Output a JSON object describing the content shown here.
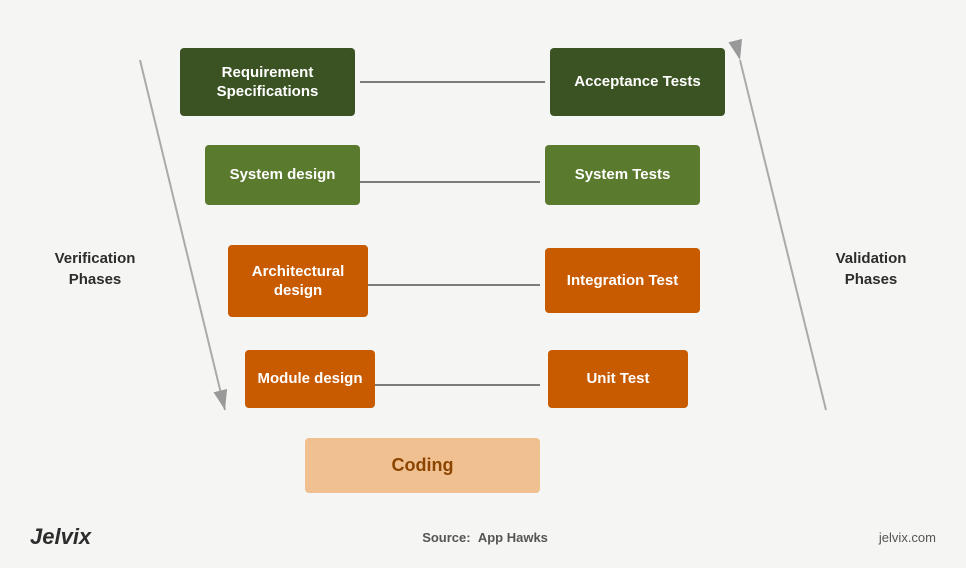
{
  "footer": {
    "logo": "Jelvix",
    "source_label": "Source:",
    "source_value": "App Hawks",
    "url": "jelvix.com"
  },
  "side_labels": {
    "left": "Verification\nPhases",
    "right": "Validation\nPhases"
  },
  "boxes": {
    "requirement": "Requirement\nSpecifications",
    "acceptance": "Acceptance Tests",
    "system_design": "System design",
    "system_tests": "System Tests",
    "arch_design": "Architectural\ndesign",
    "integration_test": "Integration Test",
    "module_design": "Module design",
    "unit_test": "Unit Test",
    "coding": "Coding"
  }
}
